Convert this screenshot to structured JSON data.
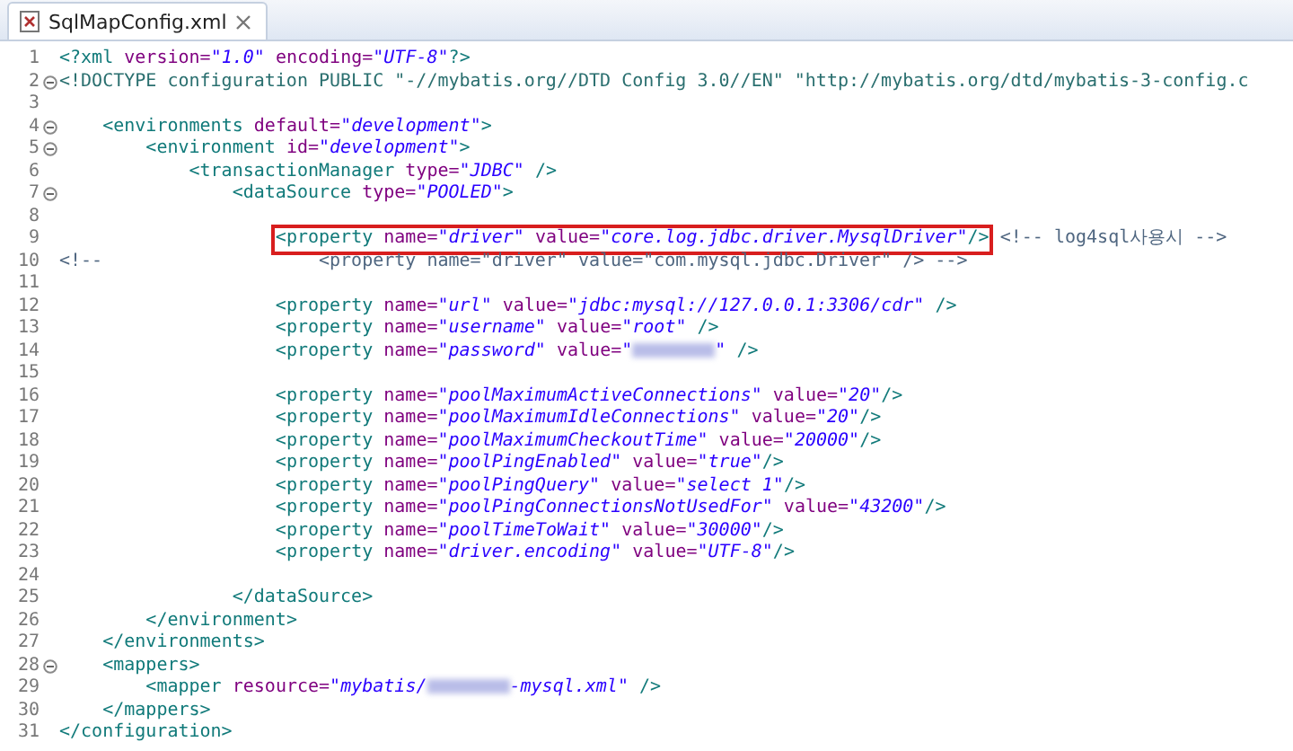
{
  "tab": {
    "title": "SqlMapConfig.xml",
    "selected": true
  },
  "lines": [
    {
      "n": "1",
      "fold": false,
      "tokens": [
        {
          "kind": "tag",
          "t": "<?xml"
        },
        {
          "kind": "attr",
          "t": " version="
        },
        {
          "kind": "val",
          "t": "\"1.0\""
        },
        {
          "kind": "attr",
          "t": " encoding="
        },
        {
          "kind": "val",
          "t": "\"UTF-8\""
        },
        {
          "kind": "tag",
          "t": "?>"
        }
      ]
    },
    {
      "n": "2",
      "fold": true,
      "tokens": [
        {
          "kind": "doctype",
          "t": "<!DOCTYPE configuration PUBLIC \"-//mybatis.org//DTD Config 3.0//EN\" \"http://mybatis.org/dtd/mybatis-3-config.c"
        }
      ]
    },
    {
      "n": "3",
      "fold": false
    },
    {
      "n": "4",
      "fold": true,
      "tokens": [
        {
          "kind": "tag",
          "t": "    <environments"
        },
        {
          "kind": "attr",
          "t": " default="
        },
        {
          "kind": "val",
          "t": "\"development\""
        },
        {
          "kind": "tag",
          "t": ">"
        }
      ]
    },
    {
      "n": "5",
      "fold": true,
      "tokens": [
        {
          "kind": "tag",
          "t": "        <environment"
        },
        {
          "kind": "attr",
          "t": " id="
        },
        {
          "kind": "val",
          "t": "\"development\""
        },
        {
          "kind": "tag",
          "t": ">"
        }
      ]
    },
    {
      "n": "6",
      "fold": false,
      "tokens": [
        {
          "kind": "tag",
          "t": "            <transactionManager"
        },
        {
          "kind": "attr",
          "t": " type="
        },
        {
          "kind": "val",
          "t": "\"JDBC\""
        },
        {
          "kind": "tag",
          "t": " />"
        }
      ]
    },
    {
      "n": "7",
      "fold": true,
      "tokens": [
        {
          "kind": "tag",
          "t": "                <dataSource"
        },
        {
          "kind": "attr",
          "t": " type="
        },
        {
          "kind": "val",
          "t": "\"POOLED\""
        },
        {
          "kind": "tag",
          "t": ">"
        }
      ]
    },
    {
      "n": "8",
      "fold": false
    },
    {
      "n": "9",
      "fold": false,
      "tokens": [
        {
          "kind": "group",
          "highlighted": true,
          "tokens": [
            {
              "kind": "tag",
              "t": "                    <property"
            },
            {
              "kind": "attr",
              "t": " name="
            },
            {
              "kind": "val",
              "t": "\"driver\""
            },
            {
              "kind": "attr",
              "t": " value="
            },
            {
              "kind": "val",
              "t": "\"core.log.jdbc.driver.MysqlDriver\""
            },
            {
              "kind": "tag",
              "t": "/>"
            }
          ]
        },
        {
          "kind": "comment",
          "t": " <!-- log4sql사용시 -->"
        }
      ]
    },
    {
      "n": "10",
      "fold": false,
      "tokens": [
        {
          "kind": "comment",
          "t": "<!--                    <property name=\"driver\" value=\"com.mysql.jdbc.Driver\" /> -->"
        }
      ]
    },
    {
      "n": "11",
      "fold": false
    },
    {
      "n": "12",
      "fold": false,
      "tokens": [
        {
          "kind": "tag",
          "t": "                    <property"
        },
        {
          "kind": "attr",
          "t": " name="
        },
        {
          "kind": "val",
          "t": "\"url\""
        },
        {
          "kind": "attr",
          "t": " value="
        },
        {
          "kind": "val",
          "t": "\"jdbc:mysql://127.0.0.1:3306/cdr\""
        },
        {
          "kind": "tag",
          "t": " />"
        }
      ]
    },
    {
      "n": "13",
      "fold": false,
      "tokens": [
        {
          "kind": "tag",
          "t": "                    <property"
        },
        {
          "kind": "attr",
          "t": " name="
        },
        {
          "kind": "val",
          "t": "\"username\""
        },
        {
          "kind": "attr",
          "t": " value="
        },
        {
          "kind": "val",
          "t": "\"root\""
        },
        {
          "kind": "tag",
          "t": " />"
        }
      ]
    },
    {
      "n": "14",
      "fold": false,
      "tokens": [
        {
          "kind": "tag",
          "t": "                    <property"
        },
        {
          "kind": "attr",
          "t": " name="
        },
        {
          "kind": "val",
          "t": "\"password\""
        },
        {
          "kind": "attr",
          "t": " value="
        },
        {
          "kind": "val",
          "t": "\""
        },
        {
          "kind": "blur"
        },
        {
          "kind": "val",
          "t": "\""
        },
        {
          "kind": "tag",
          "t": " />"
        }
      ]
    },
    {
      "n": "15",
      "fold": false
    },
    {
      "n": "16",
      "fold": false,
      "tokens": [
        {
          "kind": "tag",
          "t": "                    <property"
        },
        {
          "kind": "attr",
          "t": " name="
        },
        {
          "kind": "val",
          "t": "\"poolMaximumActiveConnections\""
        },
        {
          "kind": "attr",
          "t": " value="
        },
        {
          "kind": "val",
          "t": "\"20\""
        },
        {
          "kind": "tag",
          "t": "/>"
        }
      ]
    },
    {
      "n": "17",
      "fold": false,
      "tokens": [
        {
          "kind": "tag",
          "t": "                    <property"
        },
        {
          "kind": "attr",
          "t": " name="
        },
        {
          "kind": "val",
          "t": "\"poolMaximumIdleConnections\""
        },
        {
          "kind": "attr",
          "t": " value="
        },
        {
          "kind": "val",
          "t": "\"20\""
        },
        {
          "kind": "tag",
          "t": "/>"
        }
      ]
    },
    {
      "n": "18",
      "fold": false,
      "tokens": [
        {
          "kind": "tag",
          "t": "                    <property"
        },
        {
          "kind": "attr",
          "t": " name="
        },
        {
          "kind": "val",
          "t": "\"poolMaximumCheckoutTime\""
        },
        {
          "kind": "attr",
          "t": " value="
        },
        {
          "kind": "val",
          "t": "\"20000\""
        },
        {
          "kind": "tag",
          "t": "/>"
        }
      ]
    },
    {
      "n": "19",
      "fold": false,
      "tokens": [
        {
          "kind": "tag",
          "t": "                    <property"
        },
        {
          "kind": "attr",
          "t": " name="
        },
        {
          "kind": "val",
          "t": "\"poolPingEnabled\""
        },
        {
          "kind": "attr",
          "t": " value="
        },
        {
          "kind": "val",
          "t": "\"true\""
        },
        {
          "kind": "tag",
          "t": "/>"
        }
      ]
    },
    {
      "n": "20",
      "fold": false,
      "tokens": [
        {
          "kind": "tag",
          "t": "                    <property"
        },
        {
          "kind": "attr",
          "t": " name="
        },
        {
          "kind": "val",
          "t": "\"poolPingQuery\""
        },
        {
          "kind": "attr",
          "t": " value="
        },
        {
          "kind": "val",
          "t": "\"select 1\""
        },
        {
          "kind": "tag",
          "t": "/>"
        }
      ]
    },
    {
      "n": "21",
      "fold": false,
      "tokens": [
        {
          "kind": "tag",
          "t": "                    <property"
        },
        {
          "kind": "attr",
          "t": " name="
        },
        {
          "kind": "val",
          "t": "\"poolPingConnectionsNotUsedFor\""
        },
        {
          "kind": "attr",
          "t": " value="
        },
        {
          "kind": "val",
          "t": "\"43200\""
        },
        {
          "kind": "tag",
          "t": "/>"
        }
      ]
    },
    {
      "n": "22",
      "fold": false,
      "tokens": [
        {
          "kind": "tag",
          "t": "                    <property"
        },
        {
          "kind": "attr",
          "t": " name="
        },
        {
          "kind": "val",
          "t": "\"poolTimeToWait\""
        },
        {
          "kind": "attr",
          "t": " value="
        },
        {
          "kind": "val",
          "t": "\"30000\""
        },
        {
          "kind": "tag",
          "t": "/>"
        }
      ]
    },
    {
      "n": "23",
      "fold": false,
      "tokens": [
        {
          "kind": "tag",
          "t": "                    <property"
        },
        {
          "kind": "attr",
          "t": " name="
        },
        {
          "kind": "val",
          "t": "\"driver.encoding\""
        },
        {
          "kind": "attr",
          "t": " value="
        },
        {
          "kind": "val",
          "t": "\"UTF-8\""
        },
        {
          "kind": "tag",
          "t": "/>"
        }
      ]
    },
    {
      "n": "24",
      "fold": false
    },
    {
      "n": "25",
      "fold": false,
      "tokens": [
        {
          "kind": "tag",
          "t": "                </dataSource>"
        }
      ]
    },
    {
      "n": "26",
      "fold": false,
      "tokens": [
        {
          "kind": "tag",
          "t": "        </environment>"
        }
      ]
    },
    {
      "n": "27",
      "fold": false,
      "tokens": [
        {
          "kind": "tag",
          "t": "    </environments>"
        }
      ]
    },
    {
      "n": "28",
      "fold": true,
      "tokens": [
        {
          "kind": "tag",
          "t": "    <mappers>"
        }
      ]
    },
    {
      "n": "29",
      "fold": false,
      "tokens": [
        {
          "kind": "tag",
          "t": "        <mapper"
        },
        {
          "kind": "attr",
          "t": " resource="
        },
        {
          "kind": "val",
          "t": "\"mybatis/"
        },
        {
          "kind": "blur"
        },
        {
          "kind": "val",
          "t": "-mysql.xml\""
        },
        {
          "kind": "tag",
          "t": " />"
        }
      ]
    },
    {
      "n": "30",
      "fold": false,
      "tokens": [
        {
          "kind": "tag",
          "t": "    </mappers>"
        }
      ]
    },
    {
      "n": "31",
      "fold": false,
      "tokens": [
        {
          "kind": "tag",
          "t": "</configuration>"
        }
      ]
    }
  ]
}
